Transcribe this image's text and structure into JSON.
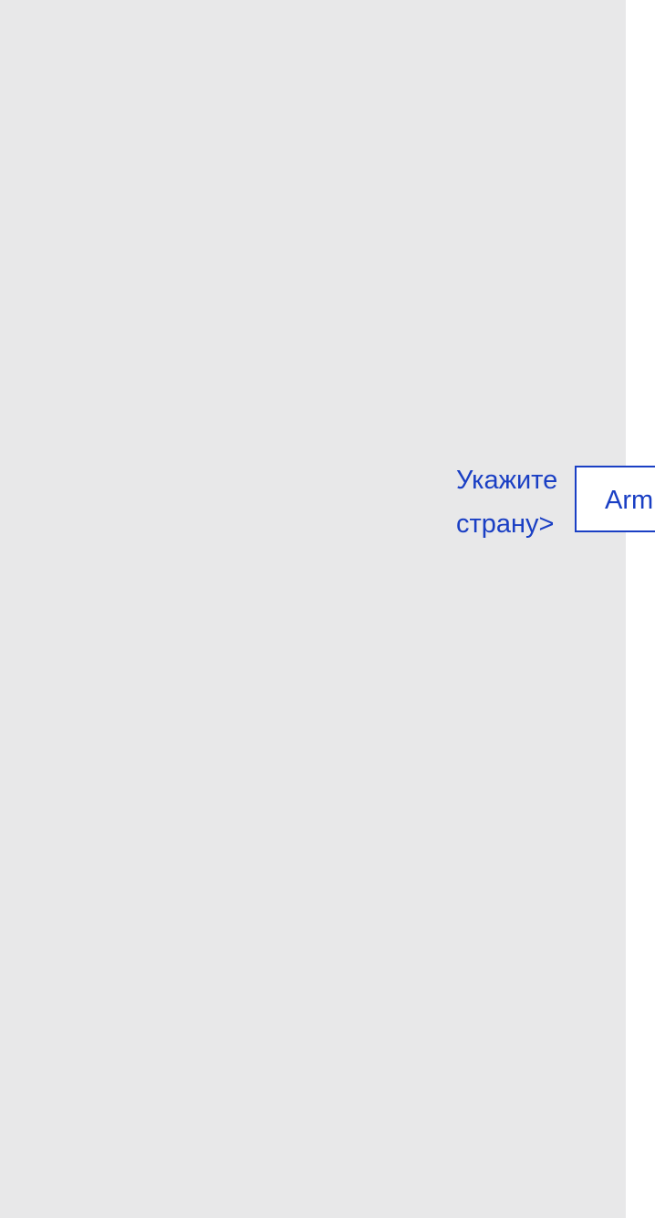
{
  "prompt": {
    "line1": "Укажите",
    "line2": "страну>"
  },
  "country_select": {
    "selected_value": "Arm"
  },
  "colors": {
    "accent": "#1a3fc4",
    "panel_background": "#e8e8e9",
    "page_background": "#ffffff"
  }
}
